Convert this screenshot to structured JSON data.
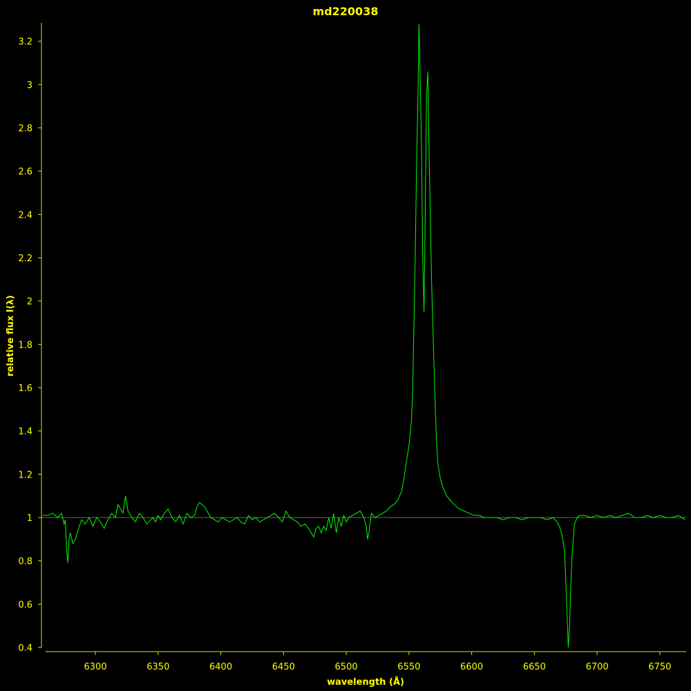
{
  "colors": {
    "background": "#000000",
    "axis": "#e6e600",
    "text": "#ffff00",
    "series": "#00ff00",
    "reference_line": "#8a8a8a"
  },
  "chart_data": {
    "type": "line",
    "title": "md220038",
    "xlabel": "wavelength (Å)",
    "ylabel": "relative flux I(λ)",
    "xlim": [
      6257,
      6771
    ],
    "ylim": [
      0.381,
      3.285
    ],
    "xticks": [
      6300,
      6350,
      6400,
      6450,
      6500,
      6550,
      6600,
      6650,
      6700,
      6750
    ],
    "yticks": [
      0.4,
      0.6,
      0.8,
      1,
      1.2,
      1.4,
      1.6,
      1.8,
      2,
      2.2,
      2.4,
      2.6,
      2.8,
      3,
      3.2
    ],
    "xtick_labels": [
      "6300",
      "6350",
      "6400",
      "6450",
      "6500",
      "6550",
      "6600",
      "6650",
      "6700",
      "6750"
    ],
    "ytick_labels": [
      "0.4",
      "0.6",
      "0.8",
      "1",
      "1.2",
      "1.4",
      "1.6",
      "1.8",
      "2",
      "2.2",
      "2.4",
      "2.6",
      "2.8",
      "3",
      "3.2"
    ],
    "reference_line_y": 1.0,
    "grid": false,
    "series": [
      {
        "x": [
          6258,
          6262,
          6266,
          6270,
          6273,
          6275,
          6276,
          6277,
          6278,
          6279,
          6280,
          6282,
          6284,
          6286,
          6289,
          6292,
          6295,
          6298,
          6301,
          6304,
          6307,
          6310,
          6313,
          6316,
          6318,
          6320,
          6322,
          6324,
          6326,
          6329,
          6332,
          6335,
          6338,
          6341,
          6344,
          6346,
          6348,
          6350,
          6352,
          6355,
          6358,
          6361,
          6364,
          6367,
          6370,
          6373,
          6376,
          6379,
          6381,
          6383,
          6385,
          6387,
          6389,
          6392,
          6395,
          6398,
          6401,
          6404,
          6407,
          6410,
          6413,
          6416,
          6419,
          6422,
          6425,
          6428,
          6431,
          6434,
          6437,
          6440,
          6443,
          6446,
          6449,
          6452,
          6455,
          6458,
          6461,
          6464,
          6467,
          6470,
          6472,
          6474,
          6476,
          6478,
          6480,
          6482,
          6484,
          6486,
          6488,
          6490,
          6492,
          6494,
          6496,
          6498,
          6500,
          6502,
          6505,
          6508,
          6511,
          6514,
          6516,
          6517,
          6518,
          6520,
          6523,
          6526,
          6529,
          6532,
          6535,
          6538,
          6541,
          6544,
          6546,
          6548,
          6550,
          6552,
          6553,
          6554,
          6555,
          6556,
          6557,
          6558,
          6559,
          6560,
          6561,
          6562,
          6563,
          6564,
          6565,
          6566,
          6567,
          6568,
          6569,
          6570,
          6571,
          6572,
          6573,
          6575,
          6577,
          6580,
          6583,
          6586,
          6590,
          6594,
          6598,
          6602,
          6606,
          6610,
          6615,
          6620,
          6625,
          6630,
          6635,
          6640,
          6645,
          6650,
          6655,
          6660,
          6665,
          6668,
          6670,
          6672,
          6674,
          6675,
          6676,
          6677,
          6678,
          6679,
          6680,
          6681,
          6682,
          6684,
          6686,
          6690,
          6695,
          6700,
          6705,
          6710,
          6715,
          6720,
          6725,
          6730,
          6735,
          6740,
          6745,
          6750,
          6755,
          6760,
          6765,
          6770
        ],
        "y": [
          1.01,
          1.01,
          1.02,
          1.0,
          1.02,
          0.97,
          0.99,
          0.86,
          0.79,
          0.9,
          0.93,
          0.88,
          0.9,
          0.94,
          0.99,
          0.97,
          1.0,
          0.96,
          1.0,
          0.98,
          0.95,
          0.99,
          1.02,
          1.0,
          1.06,
          1.04,
          1.02,
          1.1,
          1.03,
          1.0,
          0.98,
          1.02,
          1.0,
          0.97,
          0.99,
          1.0,
          0.98,
          1.01,
          0.99,
          1.02,
          1.04,
          1.0,
          0.98,
          1.01,
          0.97,
          1.02,
          1.0,
          1.01,
          1.05,
          1.07,
          1.06,
          1.05,
          1.03,
          1.0,
          0.99,
          0.98,
          1.0,
          0.99,
          0.98,
          0.99,
          1.0,
          0.98,
          0.97,
          1.01,
          0.99,
          1.0,
          0.98,
          0.99,
          1.0,
          1.01,
          1.02,
          1.0,
          0.98,
          1.03,
          1.0,
          0.99,
          0.98,
          0.96,
          0.97,
          0.95,
          0.93,
          0.91,
          0.95,
          0.96,
          0.93,
          0.96,
          0.94,
          1.0,
          0.95,
          1.02,
          0.93,
          1.0,
          0.96,
          1.01,
          0.98,
          1.0,
          1.01,
          1.02,
          1.03,
          1.0,
          0.96,
          0.9,
          0.93,
          1.02,
          1.0,
          1.01,
          1.02,
          1.03,
          1.05,
          1.06,
          1.08,
          1.12,
          1.18,
          1.26,
          1.33,
          1.45,
          1.6,
          1.9,
          2.2,
          2.6,
          2.9,
          3.28,
          3.0,
          2.7,
          2.2,
          1.95,
          2.4,
          2.95,
          3.06,
          2.7,
          2.4,
          2.1,
          1.9,
          1.7,
          1.5,
          1.35,
          1.25,
          1.18,
          1.14,
          1.1,
          1.08,
          1.06,
          1.04,
          1.03,
          1.02,
          1.01,
          1.01,
          1.0,
          1.0,
          1.0,
          0.99,
          1.0,
          1.0,
          0.99,
          1.0,
          1.0,
          1.0,
          0.99,
          1.0,
          0.98,
          0.96,
          0.92,
          0.85,
          0.72,
          0.55,
          0.4,
          0.5,
          0.68,
          0.82,
          0.9,
          0.97,
          1.0,
          1.01,
          1.01,
          1.0,
          1.01,
          1.0,
          1.01,
          1.0,
          1.01,
          1.02,
          1.0,
          1.0,
          1.01,
          1.0,
          1.01,
          1.0,
          1.0,
          1.01,
          0.99
        ]
      }
    ]
  }
}
